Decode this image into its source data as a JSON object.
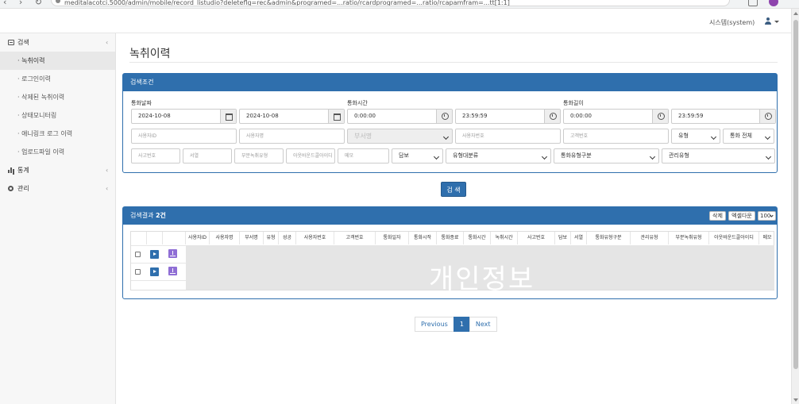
{
  "browser": {
    "url": "meditalacotci.5000/admin/mobile/record_listudio?deleteflg=rec&admin&programed=...ratio/rcardprogramed=...ratio/rcapamfram=...tt[1:1]"
  },
  "header": {
    "user_name": "시스템(system)"
  },
  "sidebar": {
    "sections": [
      {
        "label": "검색",
        "icon": "search-icon"
      },
      {
        "label": "통계",
        "icon": "chart-icon"
      },
      {
        "label": "관리",
        "icon": "gear-icon"
      }
    ],
    "items": [
      {
        "label": "· 녹취이력"
      },
      {
        "label": "· 로그인이력"
      },
      {
        "label": "· 삭제된 녹취이력"
      },
      {
        "label": "· 상태모니터링"
      },
      {
        "label": "· 애니링크 로그 이력"
      },
      {
        "label": "· 업로드파일 이력"
      }
    ]
  },
  "page": {
    "title": "녹취이력"
  },
  "search_panel": {
    "title": "검색조건",
    "call_date_label": "통화날짜",
    "call_time_label": "통화시간",
    "call_length_label": "통화길이",
    "date_from": "2024-10-08",
    "date_to": "2024-10-08",
    "time_from": "0:00:00",
    "time_to": "23:59:59",
    "length_from": "0:00:00",
    "length_to": "23:59:59",
    "row1": {
      "user_id_ph": "사용자ID",
      "user_name_ph": "사용자명",
      "dept_ph": "부서명",
      "user_no_ph": "사용자번호",
      "customer_no_ph": "고객번호",
      "type_value": "유형",
      "call_all_value": "통화 전체"
    },
    "row2": {
      "accident_no_ph": "사고번호",
      "cell_ph": "서열",
      "partial_rec_ph": "부분녹취유형",
      "outbound_id_ph": "아웃바운드콜아이디",
      "memo_ph": "메모",
      "dambo_value": "담보",
      "type_major_value": "유형대분류",
      "call_type_cat_value": "통화유형구분",
      "mgmt_type_value": "관리유형"
    },
    "search_button": "검 색"
  },
  "results_panel": {
    "title_prefix": "검색결과 ",
    "count": "2건",
    "delete_button": "삭제",
    "excel_button": "엑셀다운",
    "page_size": "100"
  },
  "table": {
    "columns": [
      "사용자ID",
      "사용자명",
      "부서명",
      "유형",
      "성공",
      "사용자번호",
      "고객번호",
      "통화일자",
      "통화시작",
      "통화종료",
      "통화시간",
      "녹취시간",
      "사고번호",
      "담보",
      "서열",
      "통화유형구분",
      "관리유형",
      "부분녹취유형",
      "아웃바운드콜아이디",
      "메모"
    ],
    "redaction_text": "개인정보",
    "rows": 2
  },
  "pagination": {
    "prev": "Previous",
    "current": "1",
    "next": "Next"
  }
}
